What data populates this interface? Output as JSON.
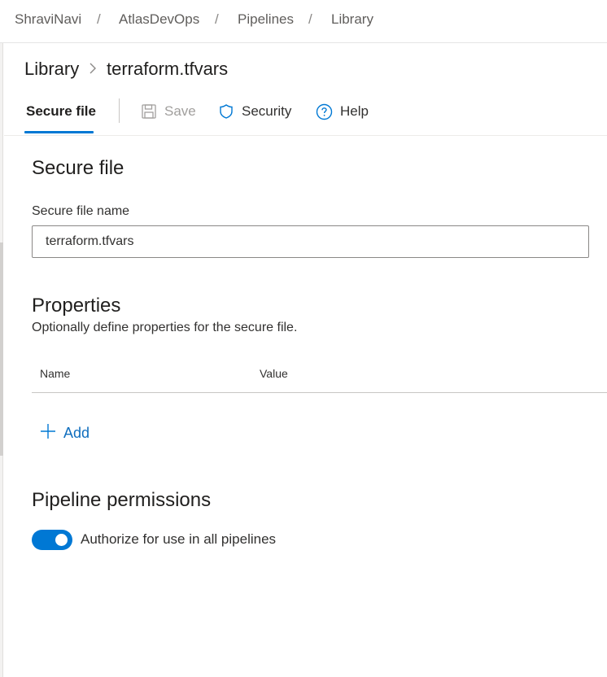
{
  "breadcrumb": {
    "items": [
      "ShraviNavi",
      "AtlasDevOps",
      "Pipelines",
      "Library"
    ],
    "separator": "/"
  },
  "header": {
    "title_parent": "Library",
    "title_current": "terraform.tfvars",
    "chevron": ">"
  },
  "toolbar": {
    "active_tab": "Secure file",
    "save_label": "Save",
    "save_enabled": false,
    "security_label": "Security",
    "help_label": "Help"
  },
  "secure_file_section": {
    "heading": "Secure file",
    "name_label": "Secure file name",
    "name_value": "terraform.tfvars"
  },
  "properties_section": {
    "heading": "Properties",
    "description": "Optionally define properties for the secure file.",
    "columns": [
      "Name",
      "Value"
    ],
    "rows": [],
    "add_label": "Add"
  },
  "permissions_section": {
    "heading": "Pipeline permissions",
    "toggle_label": "Authorize for use in all pipelines",
    "toggle_on": true
  },
  "colors": {
    "accent": "#0078d4",
    "text": "#201f1e",
    "muted": "#605e5c"
  },
  "icons": {
    "save": "save-icon",
    "security": "shield-icon",
    "help": "help-circle-icon",
    "add": "plus-icon",
    "chevron": "chevron-right-icon"
  }
}
